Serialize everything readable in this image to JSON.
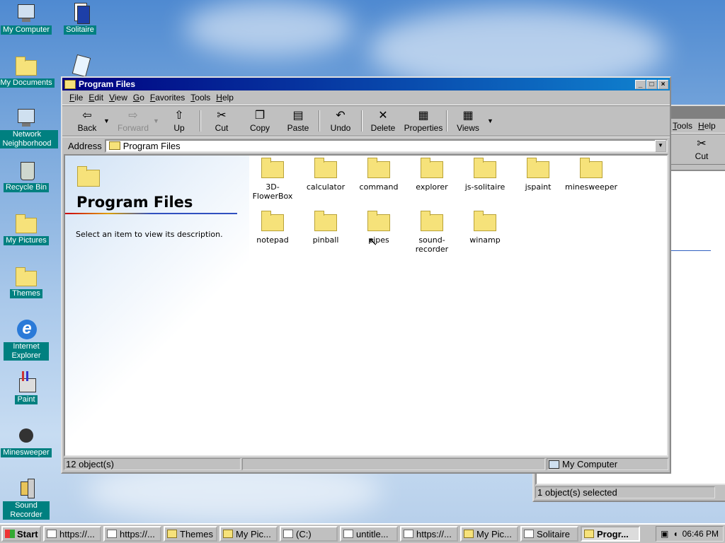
{
  "desktop": {
    "icons": [
      {
        "label": "My Computer"
      },
      {
        "label": "Solitaire"
      },
      {
        "label": "My Documents"
      },
      {
        "label": "Network Neighborhood"
      },
      {
        "label": "Recycle Bin"
      },
      {
        "label": "My Pictures"
      },
      {
        "label": "Themes"
      },
      {
        "label": "Internet Explorer"
      },
      {
        "label": "Paint"
      },
      {
        "label": "Minesweeper"
      },
      {
        "label": "Sound Recorder"
      }
    ]
  },
  "bg_window": {
    "menu": [
      "Tools",
      "Help"
    ],
    "tool": "Cut",
    "status": "1 object(s) selected"
  },
  "window": {
    "title": "Program Files",
    "menu": [
      "File",
      "Edit",
      "View",
      "Go",
      "Favorites",
      "Tools",
      "Help"
    ],
    "toolbar": {
      "back": "Back",
      "forward": "Forward",
      "up": "Up",
      "cut": "Cut",
      "copy": "Copy",
      "paste": "Paste",
      "undo": "Undo",
      "delete": "Delete",
      "properties": "Properties",
      "views": "Views"
    },
    "address_label": "Address",
    "address_value": "Program Files",
    "panel_title": "Program Files",
    "panel_desc": "Select an item to view its description.",
    "folders": [
      "3D-FlowerBox",
      "calculator",
      "command",
      "explorer",
      "js-solitaire",
      "jspaint",
      "minesweeper",
      "notepad",
      "pinball",
      "pipes",
      "sound-recorder",
      "winamp"
    ],
    "status_left": "12 object(s)",
    "status_right": "My Computer"
  },
  "taskbar": {
    "start": "Start",
    "buttons": [
      "https://...",
      "https://...",
      "Themes",
      "My Pic...",
      "(C:)",
      "untitle...",
      "https://...",
      "My Pic...",
      "Solitaire",
      "Progr..."
    ],
    "clock": "06:46 PM"
  }
}
